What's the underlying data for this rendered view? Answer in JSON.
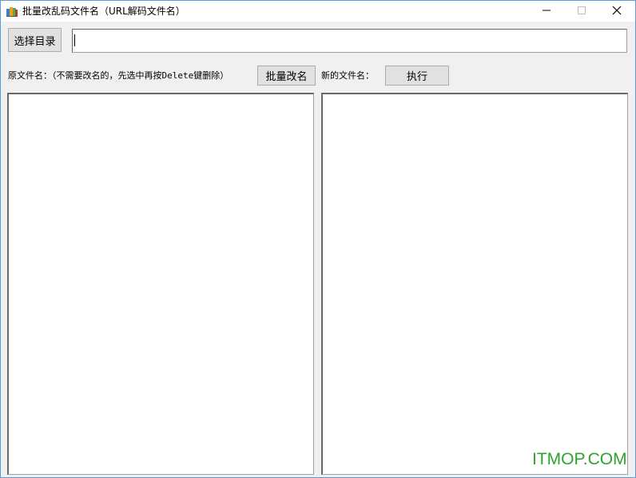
{
  "window": {
    "title": "批量改乱码文件名（URL解码文件名）",
    "icon": "app-books-icon"
  },
  "controls": {
    "minimize": "minimize-icon",
    "maximize": "maximize-icon",
    "close": "close-icon"
  },
  "toolbar": {
    "select_dir_label": "选择目录",
    "path_value": ""
  },
  "original": {
    "label": "原文件名：（不需要改名的，先选中再按Delete键删除）",
    "batch_rename_label": "批量改名",
    "items": []
  },
  "renamed": {
    "label": "新的文件名：",
    "execute_label": "执行",
    "items": []
  },
  "watermark": "ITMOP.COM",
  "colors": {
    "window_border": "#5a9ad6",
    "window_bg": "#f0f0f0",
    "button_bg": "#e1e1e1",
    "watermark": "#2fa32f"
  }
}
